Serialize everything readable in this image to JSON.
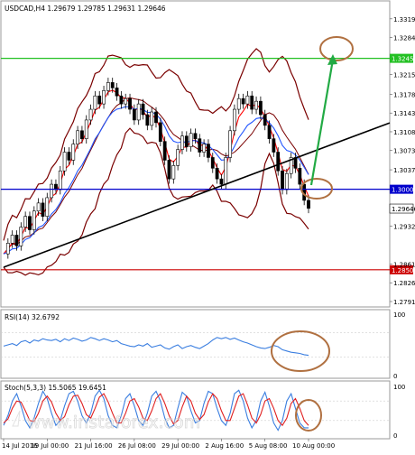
{
  "chart_data": [
    {
      "type": "line",
      "title": "USDCAD,H4 1.29679 1.29785 1.29631 1.29646",
      "xlabel": "",
      "ylabel": "",
      "ylim": [
        1.2791,
        1.3344
      ],
      "grid": false,
      "x_tick_labels": [
        "14 Jul 2016",
        "19 Jul 00:00",
        "21 Jul 16:00",
        "26 Jul 08:00",
        "29 Jul 00:00",
        "2 Aug 16:00",
        "5 Aug 08:00",
        "10 Aug 00:00"
      ],
      "y_tick_labels": [
        "1.33190",
        "1.32840",
        "1.32452",
        "1.32150",
        "1.31780",
        "1.31430",
        "1.31080",
        "1.30730",
        "1.30370",
        "1.30007",
        "1.29646",
        "1.29320",
        "1.28610",
        "1.28503",
        "1.28260",
        "1.27910"
      ],
      "series": [
        {
          "values": [
            1.288,
            1.29,
            1.2915,
            1.2895,
            1.293,
            1.295,
            1.2925,
            1.296,
            1.2975,
            1.295,
            1.2985,
            1.301,
            1.3,
            1.3035,
            1.307,
            1.3055,
            1.3085,
            1.311,
            1.3095,
            1.313,
            1.315,
            1.3175,
            1.316,
            1.3185,
            1.32,
            1.319,
            1.3175,
            1.316,
            1.317,
            1.315,
            1.313,
            1.316,
            1.314,
            1.312,
            1.3145,
            1.3125,
            1.309,
            1.3055,
            1.302,
            1.3045,
            1.3075,
            1.31,
            1.308,
            1.3105,
            1.3095,
            1.307,
            1.3085,
            1.306,
            1.304,
            1.302,
            1.301,
            1.306,
            1.311,
            1.315,
            1.317,
            1.316,
            1.3175,
            1.315,
            1.3165,
            1.314,
            1.312,
            1.3095,
            1.307,
            1.3035,
            1.3,
            1.303,
            1.306,
            1.304,
            1.301,
            1.298,
            1.2965
          ]
        }
      ],
      "levels": [
        {
          "value": 1.32452,
          "label": "1.32452",
          "color": "#22c022"
        },
        {
          "value": 1.30007,
          "label": "1.30007",
          "color": "#0000cc"
        },
        {
          "value": 1.28503,
          "label": "1.28503",
          "color": "#cc0000"
        }
      ],
      "trendline": {
        "from": [
          0,
          1.2855
        ],
        "to": [
          70,
          1.3068
        ],
        "color": "#000000"
      },
      "last_price": {
        "value": 1.29646,
        "label": "1.29646"
      },
      "annotations": [
        {
          "shape": "ellipse",
          "color": "#b07040"
        },
        {
          "shape": "ellipse",
          "color": "#b07040"
        },
        {
          "shape": "arrow",
          "color": "#22aa44",
          "direction": "up"
        }
      ],
      "indicator_colors": {
        "bollinger": "#7a0000",
        "ma_fast": "#ff0000",
        "ma_slow": "#2255ff"
      }
    },
    {
      "type": "line",
      "title": "RSI(14) 32.6792",
      "ylim": [
        0,
        100
      ],
      "y_tick_labels": [
        "100",
        "0"
      ],
      "series": [
        {
          "values": [
            48,
            50,
            52,
            49,
            55,
            57,
            53,
            58,
            56,
            60,
            58,
            57,
            59,
            55,
            60,
            57,
            61,
            59,
            56,
            58,
            62,
            60,
            57,
            60,
            58,
            55,
            57,
            52,
            50,
            48,
            47,
            50,
            48,
            52,
            46,
            48,
            50,
            45,
            43,
            47,
            50,
            44,
            47,
            49,
            46,
            44,
            48,
            52,
            58,
            62,
            60,
            62,
            59,
            61,
            58,
            55,
            53,
            50,
            47,
            45,
            44,
            46,
            49,
            47,
            42,
            40,
            38,
            37,
            36,
            34,
            33
          ]
        }
      ],
      "color": "#3a7ee0",
      "annotations": [
        {
          "shape": "ellipse",
          "color": "#b07040"
        }
      ]
    },
    {
      "type": "line",
      "title": "Stoch(5,3,3) 15.5065 19.6451",
      "ylim": [
        0,
        100
      ],
      "y_tick_labels": [
        "100",
        "0"
      ],
      "series": [
        {
          "name": "main",
          "color": "#3a7ee0",
          "values": [
            20,
            40,
            70,
            85,
            60,
            30,
            15,
            35,
            65,
            90,
            75,
            45,
            20,
            30,
            60,
            85,
            90,
            70,
            40,
            25,
            45,
            80,
            92,
            75,
            40,
            20,
            15,
            40,
            75,
            85,
            60,
            30,
            20,
            45,
            80,
            90,
            70,
            35,
            15,
            20,
            55,
            88,
            80,
            50,
            25,
            30,
            65,
            90,
            85,
            55,
            30,
            20,
            45,
            85,
            92,
            70,
            35,
            15,
            30,
            70,
            88,
            60,
            25,
            10,
            30,
            70,
            85,
            55,
            25,
            15,
            15
          ]
        },
        {
          "name": "signal",
          "color": "#e02020",
          "values": [
            25,
            33,
            55,
            70,
            68,
            50,
            30,
            28,
            45,
            70,
            80,
            68,
            45,
            30,
            38,
            62,
            80,
            82,
            65,
            42,
            35,
            55,
            78,
            85,
            68,
            45,
            25,
            25,
            45,
            70,
            75,
            58,
            35,
            30,
            50,
            75,
            85,
            65,
            40,
            23,
            30,
            58,
            80,
            70,
            45,
            32,
            42,
            68,
            85,
            75,
            50,
            30,
            30,
            55,
            80,
            85,
            62,
            35,
            25,
            42,
            70,
            75,
            55,
            30,
            20,
            35,
            65,
            75,
            55,
            30,
            20
          ]
        }
      ],
      "annotations": [
        {
          "shape": "ellipse",
          "color": "#b07040"
        }
      ]
    }
  ],
  "watermark": {
    "text": "www.instaforex.com"
  }
}
